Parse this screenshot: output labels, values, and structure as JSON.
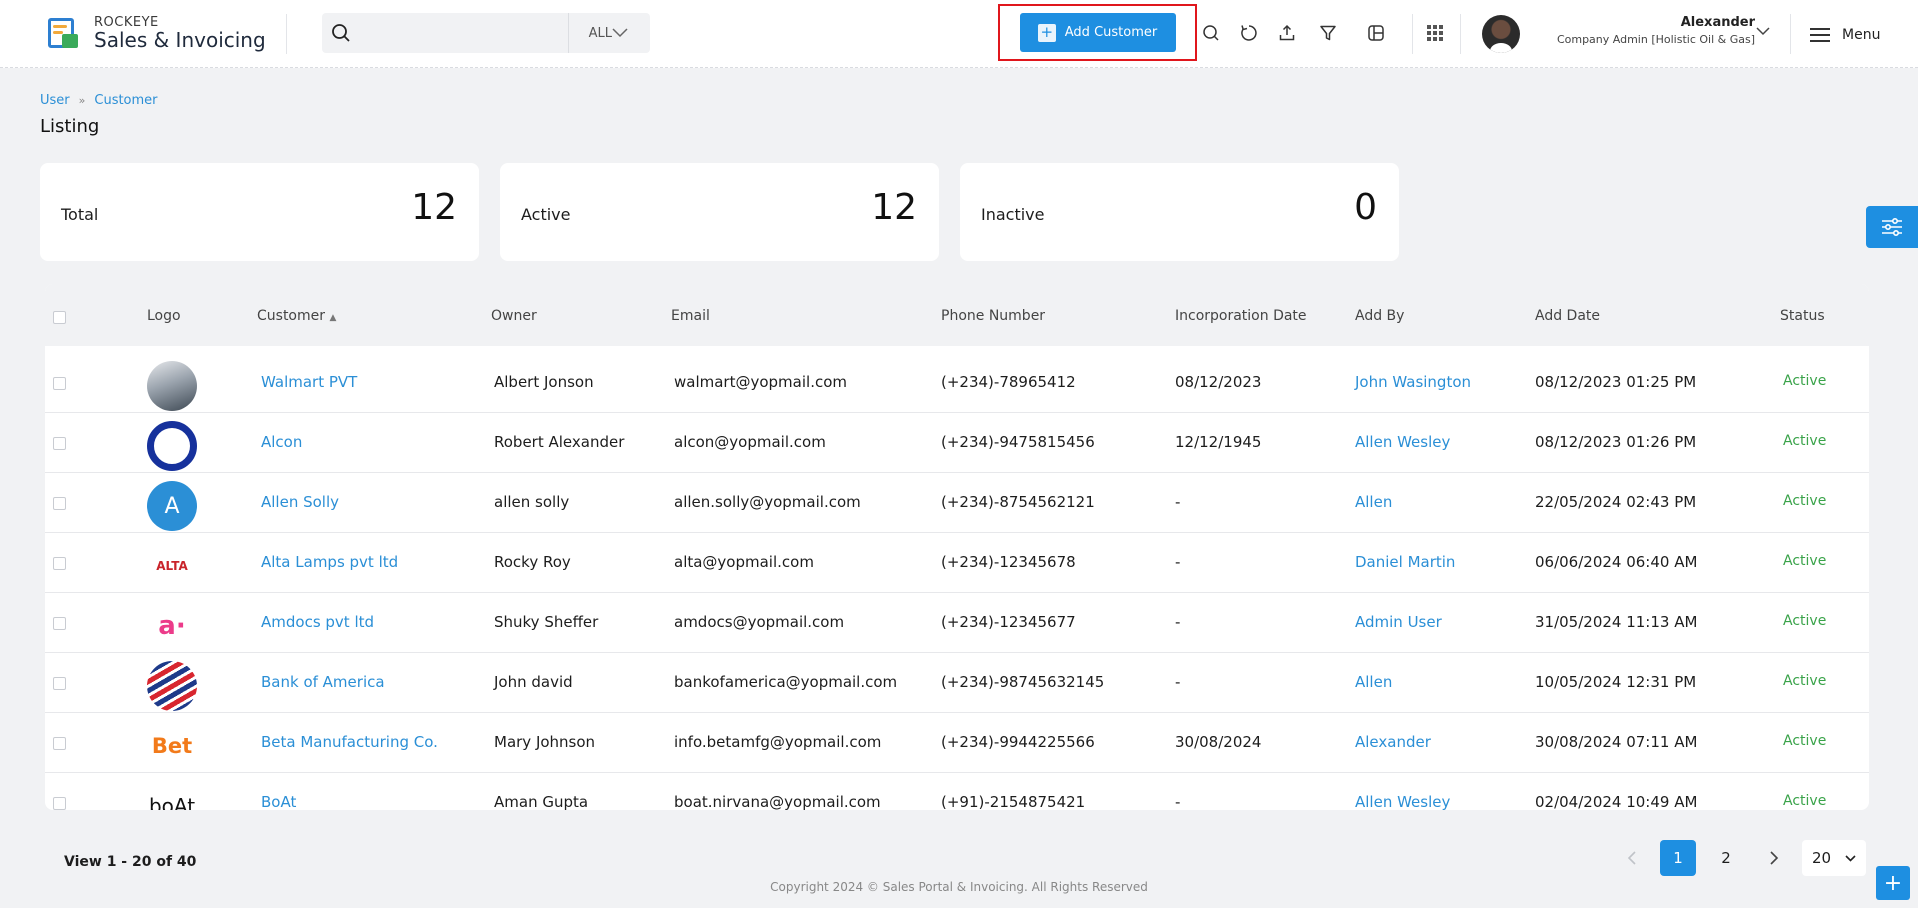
{
  "app": {
    "brand_small": "ROCKEYE",
    "brand_big": "Sales & Invoicing"
  },
  "search": {
    "placeholder": "",
    "scope": "ALL"
  },
  "toolbar": {
    "add_label": "Add Customer"
  },
  "user": {
    "name": "Alexander",
    "role": "Company Admin [Holistic Oil & Gas]"
  },
  "menu": {
    "label": "Menu"
  },
  "breadcrumb": [
    "User",
    "Customer"
  ],
  "page_title": "Listing",
  "stats": [
    {
      "label": "Total",
      "value": "12"
    },
    {
      "label": "Active",
      "value": "12"
    },
    {
      "label": "Inactive",
      "value": "0"
    }
  ],
  "table": {
    "headers": [
      "Logo",
      "Customer",
      "Owner",
      "Email",
      "Phone Number",
      "Incorporation Date",
      "Add By",
      "Add Date",
      "Status"
    ],
    "rows": [
      {
        "logo_icon": "walmart-logo",
        "customer": "Walmart PVT",
        "owner": "Albert Jonson",
        "email": "walmart@yopmail.com",
        "phone": "(+234)-78965412",
        "incorporation": "08/12/2023",
        "add_by": "John Wasington",
        "add_date": "08/12/2023 01:25 PM",
        "status": "Active"
      },
      {
        "logo_icon": "alcon-logo",
        "customer": "Alcon",
        "owner": "Robert Alexander",
        "email": "alcon@yopmail.com",
        "phone": "(+234)-9475815456",
        "incorporation": "12/12/1945",
        "add_by": "Allen Wesley",
        "add_date": "08/12/2023 01:26 PM",
        "status": "Active"
      },
      {
        "logo_icon": "letter-avatar",
        "logo_text": "A",
        "customer": "Allen Solly",
        "owner": "allen solly",
        "email": "allen.solly@yopmail.com",
        "phone": "(+234)-8754562121",
        "incorporation": "-",
        "add_by": "Allen",
        "add_date": "22/05/2024 02:43 PM",
        "status": "Active"
      },
      {
        "logo_icon": "alta-logo",
        "logo_text": "ALTA",
        "customer": "Alta Lamps pvt ltd",
        "owner": "Rocky Roy",
        "email": "alta@yopmail.com",
        "phone": "(+234)-12345678",
        "incorporation": "-",
        "add_by": "Daniel Martin",
        "add_date": "06/06/2024 06:40 AM",
        "status": "Active"
      },
      {
        "logo_icon": "amdocs-logo",
        "logo_text": "a·",
        "customer": "Amdocs pvt ltd",
        "owner": "Shuky Sheffer",
        "email": "amdocs@yopmail.com",
        "phone": "(+234)-12345677",
        "incorporation": "-",
        "add_by": "Admin User",
        "add_date": "31/05/2024 11:13 AM",
        "status": "Active"
      },
      {
        "logo_icon": "bank-of-america-logo",
        "customer": "Bank of America",
        "owner": "John david",
        "email": "bankofamerica@yopmail.com",
        "phone": "(+234)-98745632145",
        "incorporation": "-",
        "add_by": "Allen",
        "add_date": "10/05/2024 12:31 PM",
        "status": "Active"
      },
      {
        "logo_icon": "beta-logo",
        "logo_text": "Bet",
        "customer": "Beta Manufacturing Co.",
        "owner": "Mary Johnson",
        "email": "info.betamfg@yopmail.com",
        "phone": "(+234)-9944225566",
        "incorporation": "30/08/2024",
        "add_by": "Alexander",
        "add_date": "30/08/2024 07:11 AM",
        "status": "Active"
      },
      {
        "logo_icon": "boat-logo",
        "logo_text": "boAt",
        "customer": "BoAt",
        "owner": "Aman Gupta",
        "email": "boat.nirvana@yopmail.com",
        "phone": "(+91)-2154875421",
        "incorporation": "-",
        "add_by": "Allen Wesley",
        "add_date": "02/04/2024 10:49 AM",
        "status": "Active"
      }
    ]
  },
  "pagination": {
    "view_text": "View 1 - 20 of 40",
    "pages": [
      "1",
      "2"
    ],
    "current": "1",
    "per_page": "20"
  },
  "footer": {
    "copyright": "Copyright 2024 © Sales Portal & Invoicing. All Rights Reserved"
  },
  "colors": {
    "accent": "#1e8fe1",
    "link": "#2b8fd6",
    "status_active": "#3aa34a",
    "highlight_border": "#e0161c"
  }
}
